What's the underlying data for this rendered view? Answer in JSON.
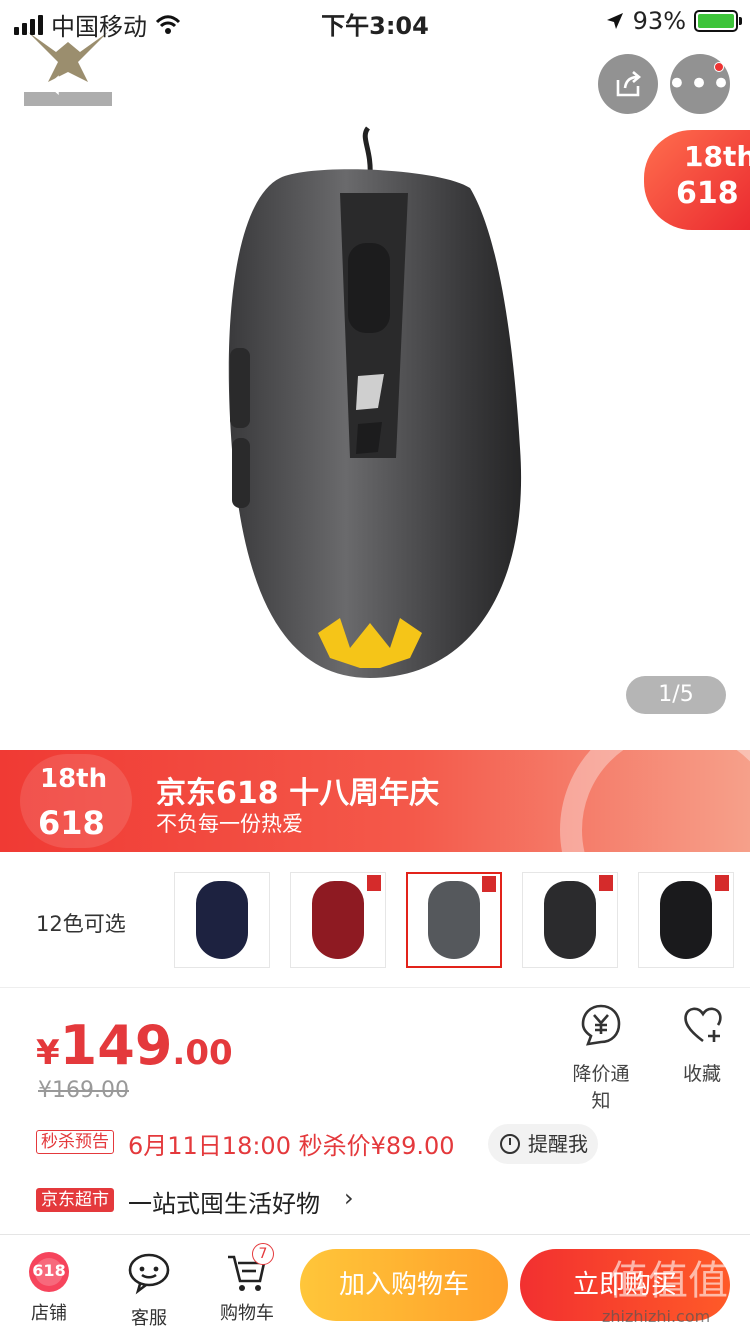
{
  "status_bar": {
    "carrier": "中国移动",
    "time": "下午3:04",
    "battery_pct": "93%"
  },
  "hero": {
    "badge_18": "18th",
    "badge_618": "618",
    "page_indicator": "1/5"
  },
  "promo": {
    "logo_18": "18th",
    "logo_618": "618",
    "title": "京东618 十八周年庆",
    "subtitle": "不负每一份热爱"
  },
  "variants": {
    "label": "12色可选",
    "items": [
      {
        "color": "#1d2240",
        "selected": false
      },
      {
        "color": "#8e1a22",
        "selected": false
      },
      {
        "color": "#55585c",
        "selected": true
      },
      {
        "color": "#2b2b2d",
        "selected": false
      },
      {
        "color": "#1a1a1c",
        "selected": false
      }
    ]
  },
  "price": {
    "currency": "¥",
    "integer": "149",
    "decimal": ".00",
    "original": "¥169.00",
    "price_alert_label": "降价通知",
    "favorite_label": "收藏"
  },
  "seckill": {
    "tag": "秒杀预告",
    "text": "6月11日18:00 秒杀价¥89.00",
    "remind_label": "提醒我"
  },
  "supermarket": {
    "tag": "京东超市",
    "text": "一站式囤生活好物",
    "arrow": "›"
  },
  "bottom_bar": {
    "shop_label": "店铺",
    "shop_icon_text": "618",
    "service_label": "客服",
    "cart_label": "购物车",
    "cart_count": "7",
    "add_to_cart": "加入购物车",
    "buy_now": "立即购买"
  },
  "colors": {
    "accent_red": "#e4393c",
    "cart_yellow": "#ffb12e"
  }
}
